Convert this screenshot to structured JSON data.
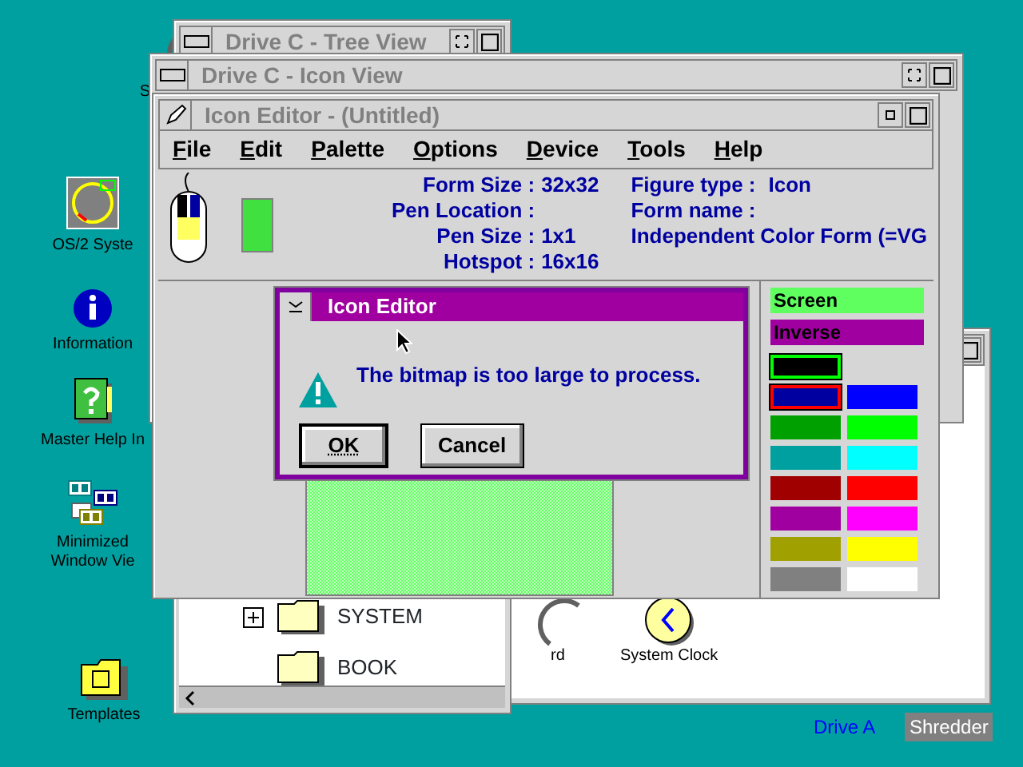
{
  "desktop_icons": [
    {
      "kind": "partial",
      "lines": [
        "S"
      ]
    },
    {
      "kind": "os2",
      "lines": [
        "OS/2 Syste"
      ]
    },
    {
      "kind": "info",
      "lines": [
        "Information"
      ]
    },
    {
      "kind": "help",
      "lines": [
        "Master Help In"
      ]
    },
    {
      "kind": "minimized",
      "lines": [
        "Minimized",
        "Window Vie"
      ]
    },
    {
      "kind": "templates",
      "lines": [
        "Templates"
      ]
    }
  ],
  "tree_view": {
    "title": "Drive C - Tree View",
    "items": [
      {
        "label": "SYSTEM",
        "expanded": false
      },
      {
        "label": "BOOK"
      }
    ]
  },
  "folder_window": {
    "items": [
      {
        "kind": "partial",
        "label": "rd"
      },
      {
        "kind": "clock",
        "label": "System Clock"
      }
    ]
  },
  "icon_view": {
    "title": "Drive C - Icon View"
  },
  "bottom_icons": [
    {
      "label": "Drive A",
      "selected": false
    },
    {
      "label": "Shredder",
      "selected": true
    }
  ],
  "icon_editor": {
    "title": "Icon Editor - (Untitled)",
    "menu": [
      "File",
      "Edit",
      "Palette",
      "Options",
      "Device",
      "Tools",
      "Help"
    ],
    "info_left": [
      {
        "label": "Form Size :",
        "value": "32x32"
      },
      {
        "label": "Pen Location :"
      },
      {
        "label": "Pen Size :",
        "value": "1x1"
      },
      {
        "label": "Hotspot :",
        "value": "16x16"
      }
    ],
    "info_right": [
      {
        "label": "Figure type :",
        "value": "Icon"
      },
      {
        "label": "Form name :"
      },
      {
        "label": "Independent Color Form (=VG"
      }
    ],
    "screen_label": "Screen",
    "inverse_label": "Inverse",
    "colors": [
      {
        "color": "#000000",
        "left_pen": true,
        "right_pen": false
      },
      {
        "color": "#0000a0",
        "left_pen": false,
        "right_pen": true
      },
      {
        "color": "#0000ff",
        "left_pen": false,
        "right_pen": false
      },
      {
        "color": "#00a000",
        "left_pen": false,
        "right_pen": false
      },
      {
        "color": "#00ff00",
        "left_pen": false,
        "right_pen": false
      },
      {
        "color": "#00a0a0",
        "left_pen": false,
        "right_pen": false
      },
      {
        "color": "#00ffff",
        "left_pen": false,
        "right_pen": false
      },
      {
        "color": "#a00000",
        "left_pen": false,
        "right_pen": false
      },
      {
        "color": "#ff0000",
        "left_pen": false,
        "right_pen": false
      },
      {
        "color": "#a000a0",
        "left_pen": false,
        "right_pen": false
      },
      {
        "color": "#ff00ff",
        "left_pen": false,
        "right_pen": false
      },
      {
        "color": "#a0a000",
        "left_pen": false,
        "right_pen": false
      },
      {
        "color": "#ffff00",
        "left_pen": false,
        "right_pen": false
      },
      {
        "color": "#808080",
        "left_pen": false,
        "right_pen": false
      },
      {
        "color": "#ffffff",
        "left_pen": false,
        "right_pen": false
      }
    ]
  },
  "dialog": {
    "title": "Icon Editor",
    "message": "The bitmap is too large to process.",
    "buttons": [
      {
        "label": "OK",
        "default": true
      },
      {
        "label": "Cancel",
        "default": false
      }
    ]
  }
}
